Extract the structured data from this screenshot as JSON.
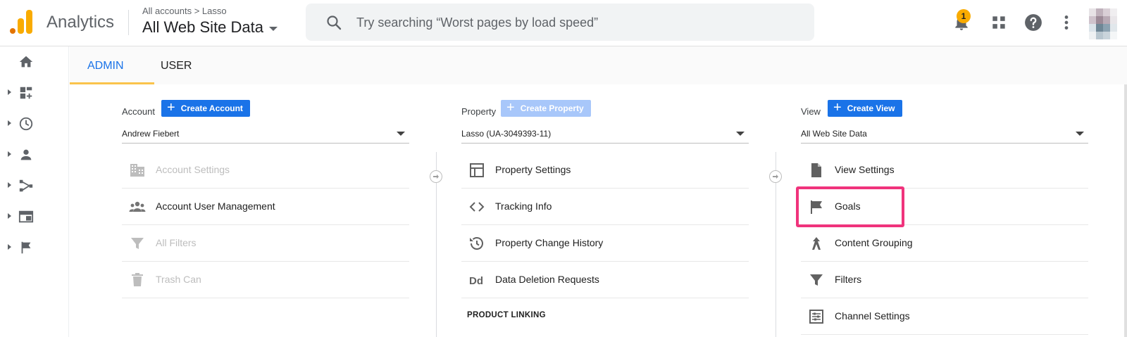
{
  "header": {
    "app_title": "Analytics",
    "breadcrumb": "All accounts > Lasso",
    "view_name": "All Web Site Data",
    "search_placeholder": "Try searching “Worst pages by load speed”",
    "notification_count": "1",
    "icons": [
      "bell-icon",
      "apps-grid-icon",
      "help-icon",
      "more-vert-icon"
    ]
  },
  "rail": {
    "items": [
      "home-icon",
      "customization-icon",
      "realtime-icon",
      "audience-icon",
      "acquisition-icon",
      "behavior-icon",
      "conversions-icon"
    ]
  },
  "tabs": [
    {
      "label": "ADMIN",
      "active": true
    },
    {
      "label": "USER",
      "active": false
    }
  ],
  "columns": {
    "account": {
      "label": "Account",
      "create_label": "Create Account",
      "selected": "Andrew Fiebert",
      "items": [
        {
          "label": "Account Settings",
          "icon": "building-icon",
          "disabled": true
        },
        {
          "label": "Account User Management",
          "icon": "people-icon",
          "disabled": false
        },
        {
          "label": "All Filters",
          "icon": "filter-icon",
          "disabled": true
        },
        {
          "label": "Trash Can",
          "icon": "trash-icon",
          "disabled": true
        }
      ]
    },
    "property": {
      "label": "Property",
      "create_label": "Create Property",
      "selected": "Lasso (UA-3049393-11)",
      "items": [
        {
          "label": "Property Settings",
          "icon": "layout-icon"
        },
        {
          "label": "Tracking Info",
          "icon": "code-icon"
        },
        {
          "label": "Property Change History",
          "icon": "history-icon"
        },
        {
          "label": "Data Deletion Requests",
          "icon": "dd-icon"
        }
      ],
      "section_heading": "PRODUCT LINKING"
    },
    "view": {
      "label": "View",
      "create_label": "Create View",
      "selected": "All Web Site Data",
      "items": [
        {
          "label": "View Settings",
          "icon": "document-icon"
        },
        {
          "label": "Goals",
          "icon": "flag-icon"
        },
        {
          "label": "Content Grouping",
          "icon": "grouping-icon"
        },
        {
          "label": "Filters",
          "icon": "filter-icon"
        },
        {
          "label": "Channel Settings",
          "icon": "channel-settings-icon"
        }
      ]
    }
  },
  "colors": {
    "accent_blue": "#1a73e8",
    "brand_orange": "#f9ab00",
    "highlight_pink": "#f0337c"
  }
}
